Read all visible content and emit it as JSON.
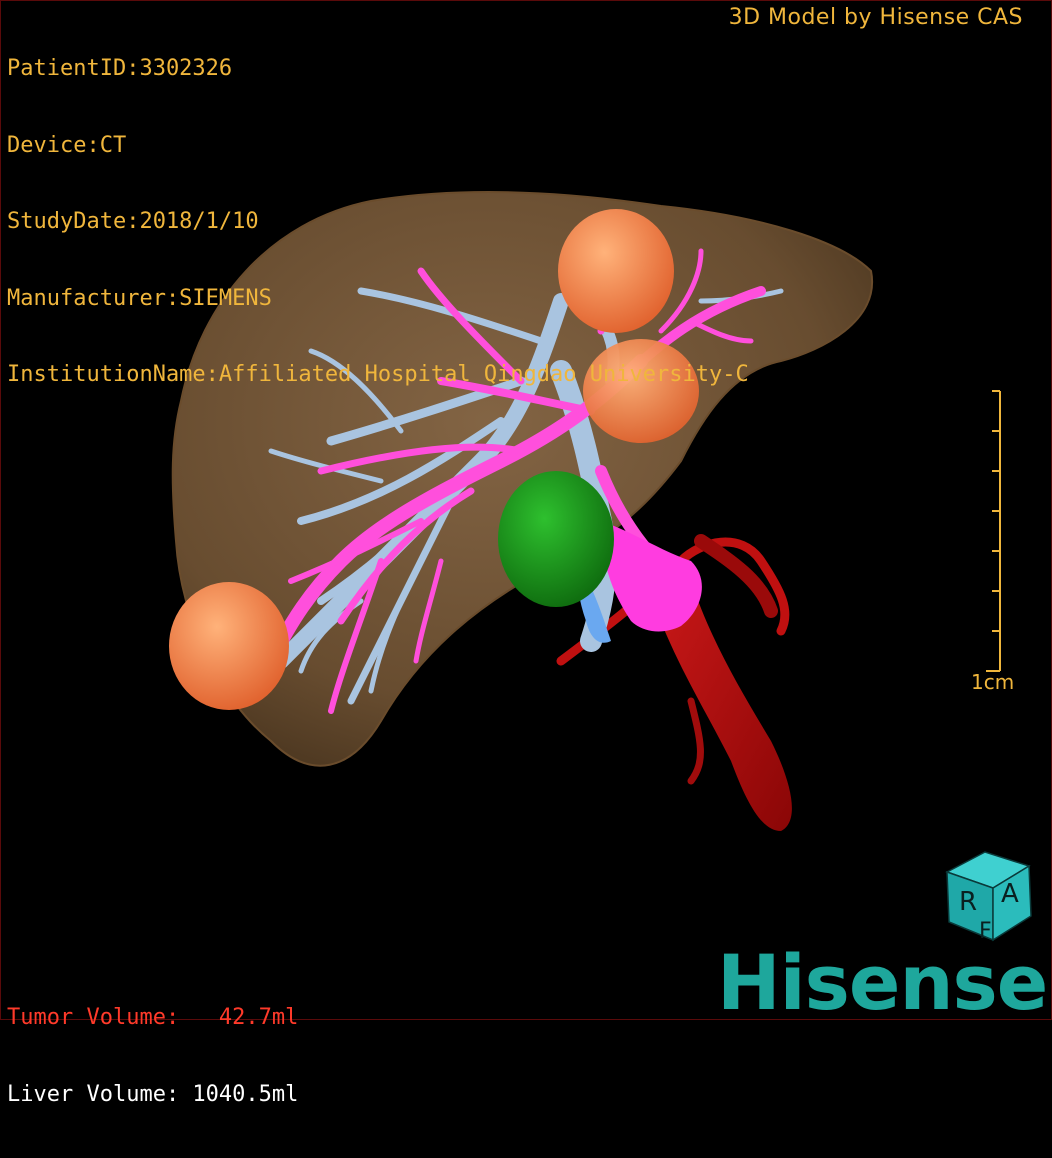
{
  "dicom_info": {
    "patient_id": "PatientID:3302326",
    "device": "Device:CT",
    "study_date": "StudyDate:2018/1/10",
    "manufacturer": "Manufacturer:SIEMENS",
    "institution": "InstitutionName:Affiliated Hospital Qingdao University-C"
  },
  "credit": "3D Model by Hisense CAS",
  "volumes": {
    "tumor": "Tumor Volume:   42.7ml",
    "liver": "Liver Volume: 1040.5ml"
  },
  "scale": {
    "label": "1cm"
  },
  "orientation_cube": {
    "labels": [
      "R",
      "A",
      "F"
    ]
  },
  "brand": "Hisense",
  "colors": {
    "overlay_text": "#f0b63c",
    "tumor_text": "#ff3a2a",
    "liver_surface": "#8a6a45",
    "portal_vein": "#ff4fdc",
    "hepatic_vein": "#a9c4e0",
    "artery": "#b00e0e",
    "tumor": "#f57f4a",
    "gallbladder_tumor": "#1f9e1f",
    "brand": "#1ea79c"
  }
}
